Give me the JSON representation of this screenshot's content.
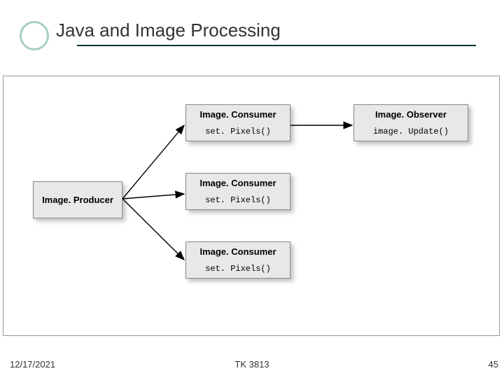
{
  "slide": {
    "title": "Java and Image Processing",
    "footer": {
      "date": "12/17/2021",
      "course_code": "TK 3813",
      "page": "45"
    }
  },
  "diagram": {
    "producer": {
      "title": "Image. Producer"
    },
    "consumers": [
      {
        "title": "Image. Consumer",
        "method": "set. Pixels()"
      },
      {
        "title": "Image. Consumer",
        "method": "set. Pixels()"
      },
      {
        "title": "Image. Consumer",
        "method": "set. Pixels()"
      }
    ],
    "observer": {
      "title": "Image. Observer",
      "method": "image. Update()"
    }
  }
}
